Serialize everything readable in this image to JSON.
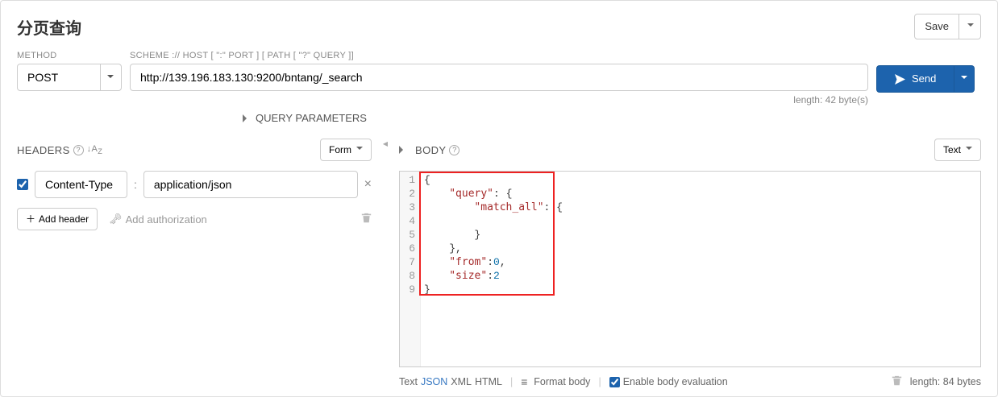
{
  "page_title": "分页查询",
  "save_button": "Save",
  "method_label": "METHOD",
  "method_value": "POST",
  "url_label": "SCHEME :// HOST [ \":\" PORT ] [ PATH [ \"?\" QUERY ]]",
  "url_value": "http://139.196.183.130:9200/bntang/_search",
  "send_label": "Send",
  "url_length": "length: 42 byte(s)",
  "query_params_label": "QUERY PARAMETERS",
  "headers": {
    "title": "HEADERS",
    "form_btn": "Form",
    "row": {
      "checked": true,
      "key": "Content-Type",
      "value": "application/json"
    },
    "add_header": "Add header",
    "add_auth": "Add authorization"
  },
  "body": {
    "title": "BODY",
    "text_btn": "Text",
    "lines": [
      "{",
      "    \"query\": {",
      "        \"match_all\": {",
      "",
      "        }",
      "    },",
      "    \"from\":0,",
      "    \"size\":2",
      "}"
    ],
    "line_numbers": [
      "1",
      "2",
      "3",
      "4",
      "5",
      "6",
      "7",
      "8",
      "9"
    ],
    "footer": {
      "fmt_text": "Text",
      "fmt_json": "JSON",
      "fmt_xml": "XML",
      "fmt_html": "HTML",
      "format_body": "Format body",
      "enable_eval": "Enable body evaluation",
      "length": "length: 84 bytes"
    }
  }
}
